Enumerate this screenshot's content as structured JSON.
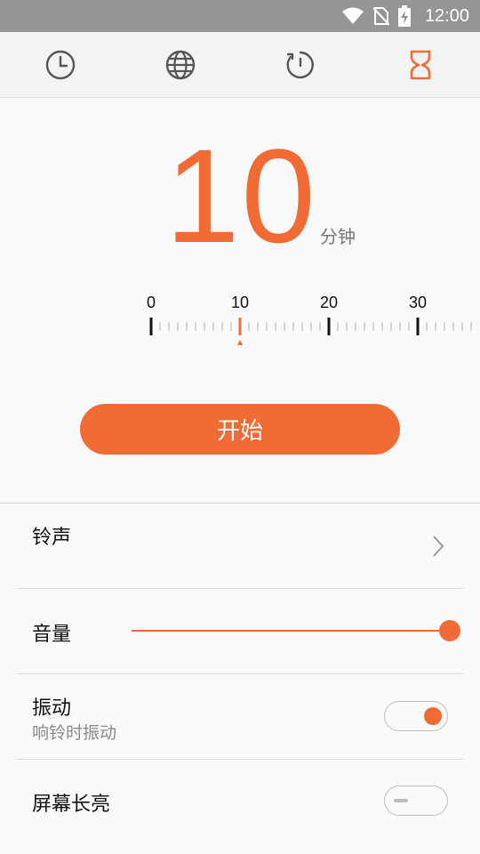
{
  "status_bar": {
    "time": "12:00",
    "icons": [
      "wifi-icon",
      "no-sim-icon",
      "battery-charging-icon"
    ]
  },
  "tabs": [
    {
      "name": "clock",
      "icon": "clock-icon",
      "active": false
    },
    {
      "name": "world-clock",
      "icon": "globe-icon",
      "active": false
    },
    {
      "name": "stopwatch",
      "icon": "stopwatch-icon",
      "active": false
    },
    {
      "name": "timer",
      "icon": "hourglass-icon",
      "active": true
    }
  ],
  "timer": {
    "value": "10",
    "unit": "分钟",
    "selected_minutes": 10
  },
  "ruler": {
    "labels": [
      "0",
      "10",
      "20",
      "30"
    ],
    "min": 0,
    "max": 36,
    "minor_step": 1
  },
  "start_button": {
    "label": "开始"
  },
  "settings": {
    "ringtone": {
      "label": "铃声"
    },
    "volume": {
      "label": "音量",
      "level": 1.0
    },
    "vibrate": {
      "label": "振动",
      "sublabel": "响铃时振动",
      "on": true
    },
    "screen_on": {
      "label": "屏幕长亮",
      "on": false
    }
  },
  "colors": {
    "accent": "#f26b35",
    "status_bar": "#959595",
    "background": "#fafafa"
  }
}
